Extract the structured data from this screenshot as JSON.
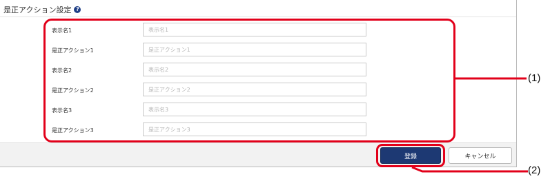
{
  "header": {
    "title": "是正アクション設定",
    "help_icon": "question-circle-icon"
  },
  "fields": [
    {
      "label": "表示名1",
      "value": "",
      "placeholder": "表示名1"
    },
    {
      "label": "是正アクション1",
      "value": "",
      "placeholder": "是正アクション1"
    },
    {
      "label": "表示名2",
      "value": "",
      "placeholder": "表示名2"
    },
    {
      "label": "是正アクション2",
      "value": "",
      "placeholder": "是正アクション2"
    },
    {
      "label": "表示名3",
      "value": "",
      "placeholder": "表示名3"
    },
    {
      "label": "是正アクション3",
      "value": "",
      "placeholder": "是正アクション3"
    }
  ],
  "buttons": {
    "register": "登録",
    "cancel": "キャンセル"
  },
  "callouts": {
    "fields": "(1)",
    "register": "(2)"
  },
  "colors": {
    "accent": "#1d3973",
    "highlight": "#e2001a",
    "help_icon": "#1f3f87",
    "footer_bg": "#f2f2f2"
  }
}
